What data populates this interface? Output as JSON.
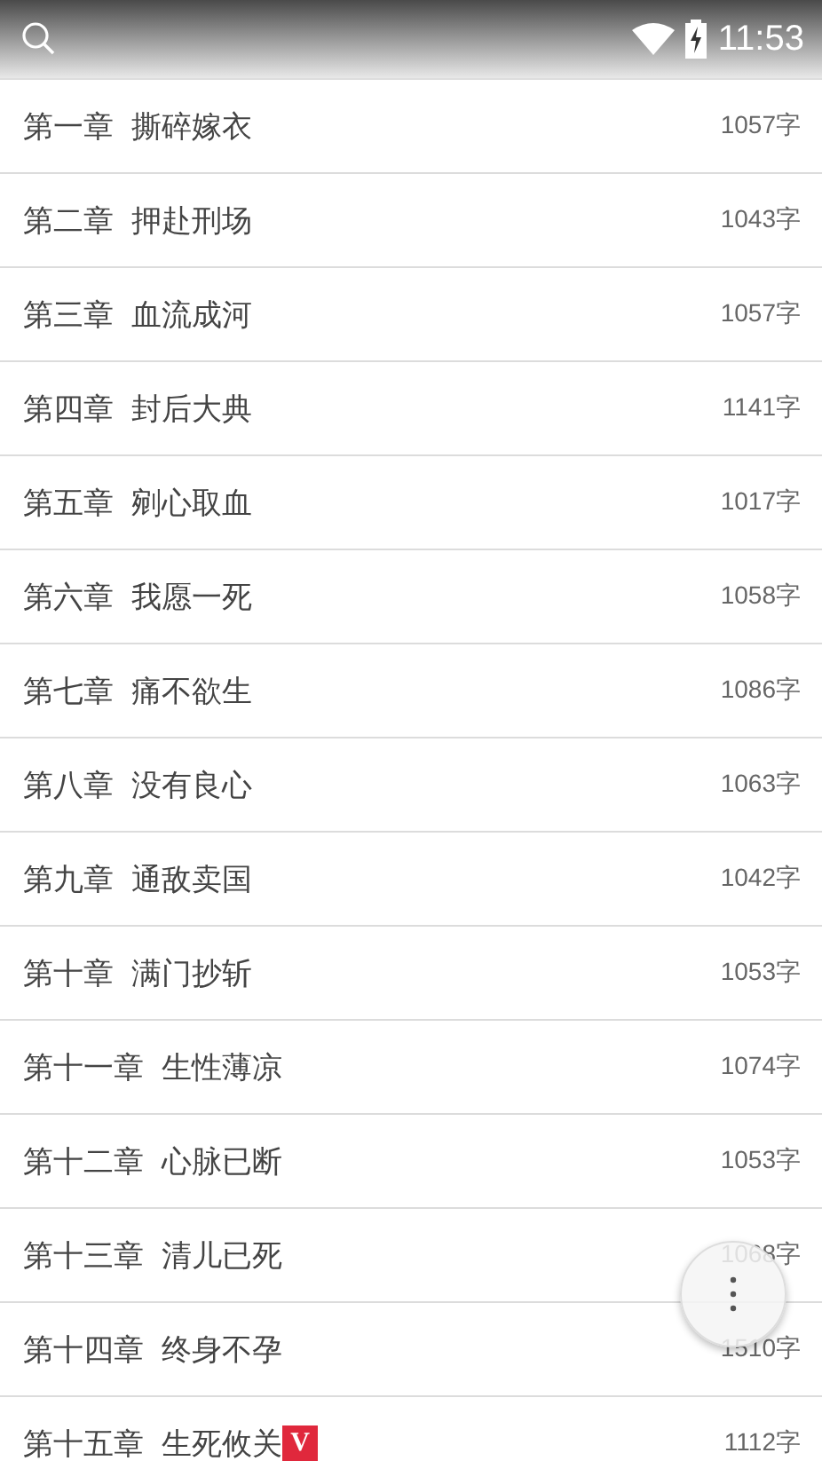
{
  "status_bar": {
    "time": "11:53"
  },
  "chapters": [
    {
      "number": "第一章",
      "title": "撕碎嫁衣",
      "count": "1057字"
    },
    {
      "number": "第二章",
      "title": "押赴刑场",
      "count": "1043字"
    },
    {
      "number": "第三章",
      "title": "血流成河",
      "count": "1057字"
    },
    {
      "number": "第四章",
      "title": "封后大典",
      "count": "1141字"
    },
    {
      "number": "第五章",
      "title": "剜心取血",
      "count": "1017字"
    },
    {
      "number": "第六章",
      "title": "我愿一死",
      "count": "1058字"
    },
    {
      "number": "第七章",
      "title": "痛不欲生",
      "count": "1086字"
    },
    {
      "number": "第八章",
      "title": "没有良心",
      "count": "1063字"
    },
    {
      "number": "第九章",
      "title": "通敌卖国",
      "count": "1042字"
    },
    {
      "number": "第十章",
      "title": "满门抄斩",
      "count": "1053字"
    },
    {
      "number": "第十一章",
      "title": "生性薄凉",
      "count": "1074字"
    },
    {
      "number": "第十二章",
      "title": "心脉已断",
      "count": "1053字"
    },
    {
      "number": "第十三章",
      "title": "清儿已死",
      "count": "1068字"
    },
    {
      "number": "第十四章",
      "title": "终身不孕",
      "count": "1510字"
    },
    {
      "number": "第十五章",
      "title": "生死攸关",
      "count": "1112字",
      "badge": "V"
    }
  ]
}
